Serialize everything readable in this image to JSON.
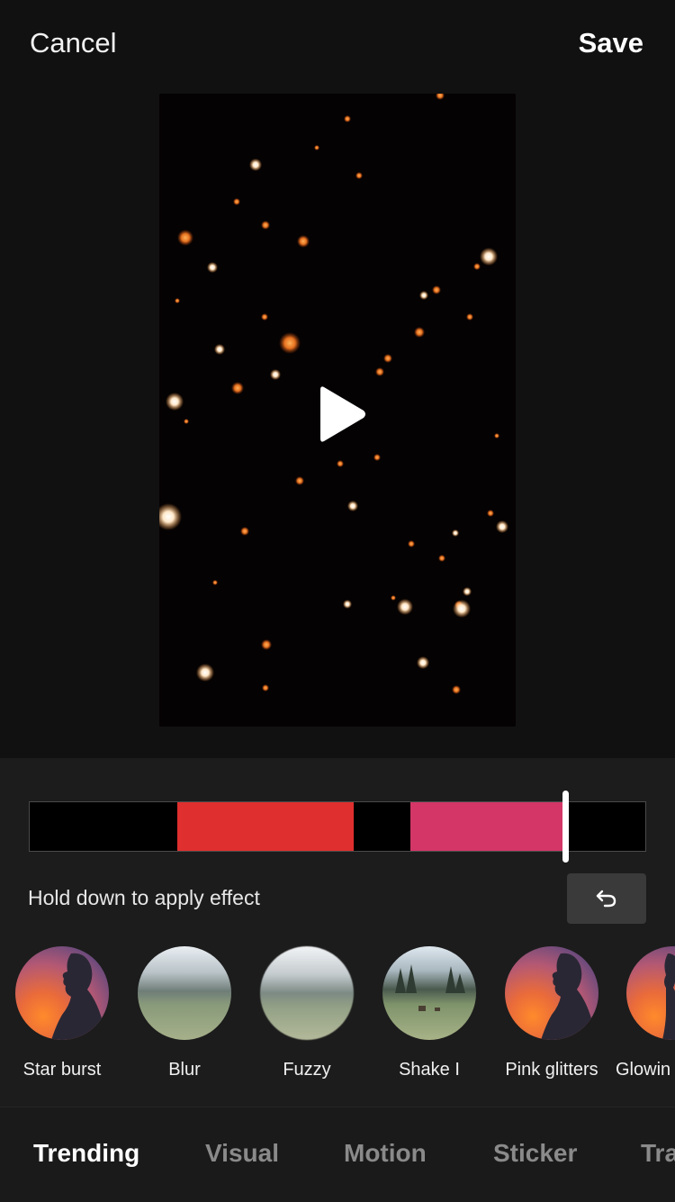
{
  "header": {
    "cancel_label": "Cancel",
    "save_label": "Save"
  },
  "timeline": {
    "progress": 0.87,
    "segments": [
      {
        "color": "#df2f2f"
      },
      {
        "color": "#d33667"
      }
    ]
  },
  "hint_text": "Hold down to apply effect",
  "effects": [
    {
      "label": "Star burst",
      "thumbnail": "silhouette-sunset"
    },
    {
      "label": "Blur",
      "thumbnail": "blurred-meadow"
    },
    {
      "label": "Fuzzy",
      "thumbnail": "fuzzy-meadow"
    },
    {
      "label": "Shake I",
      "thumbnail": "forest-deer"
    },
    {
      "label": "Pink glitters",
      "thumbnail": "silhouette-sunset"
    },
    {
      "label": "Glowin",
      "thumbnail": "silhouette-sunset"
    }
  ],
  "tabs": [
    {
      "label": "Trending",
      "active": true
    },
    {
      "label": "Visual",
      "active": false
    },
    {
      "label": "Motion",
      "active": false
    },
    {
      "label": "Sticker",
      "active": false
    },
    {
      "label": "Tra",
      "active": false
    }
  ],
  "colors": {
    "background": "#111111",
    "panel": "#1c1c1c",
    "accent_red": "#df2f2f",
    "accent_pink": "#d33667"
  },
  "icons": {
    "play": "play-icon",
    "undo": "undo-icon"
  }
}
